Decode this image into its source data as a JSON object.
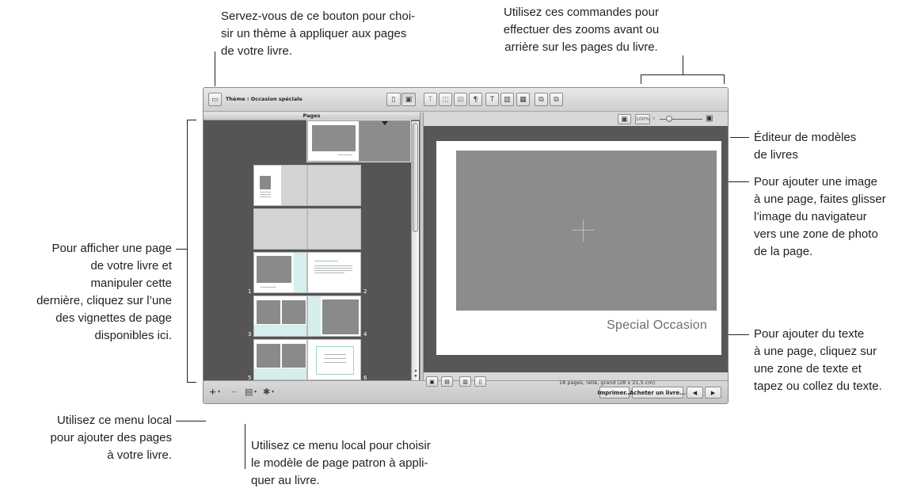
{
  "callouts": {
    "theme_button": "Servez-vous de ce bouton pour choi-\nsir un thème à appliquer aux pages\nde votre livre.",
    "zoom_controls": "Utilisez ces commandes pour\neffectuer des zooms avant ou\narrière sur les pages du livre.",
    "template_editor": "Éditeur de modèles\nde livres",
    "add_image": "Pour ajouter une image\nà une page, faites glisser\nl’image du navigateur\nvers une zone de photo\nde la page.",
    "view_page": "Pour afficher une page\nde votre livre et\nmanipuler cette\ndernière, cliquez sur l’une\ndes vignettes de page\ndisponibles ici.",
    "add_text": "Pour ajouter du texte\nà une page, cliquez sur\nune zone de texte et\ntapez ou collez du texte.",
    "add_pages_menu": "Utilisez ce menu local\npour ajouter des pages\nà votre livre.",
    "master_page_menu": "Utilisez ce menu local pour choisir\nle modèle de page patron à appli-\nquer au livre."
  },
  "toolbar": {
    "theme_label": "Thème : Occasion spéciale",
    "zoom_100_label": "100%",
    "icons": [
      "theme-icon",
      "single-page-view-icon",
      "spread-view-icon",
      "text-box-icon",
      "photo-box-icon",
      "text-style-icon",
      "stack-icon",
      "move-back-icon",
      "move-forward-icon"
    ]
  },
  "pages_panel": {
    "header": "Pages",
    "page_numbers": [
      "1",
      "2",
      "3",
      "4",
      "5",
      "6"
    ]
  },
  "editor": {
    "page_title": "Special Occasion",
    "status": "18 pages, relié, grand (28 x 21,5 cm)"
  },
  "bottom_bar": {
    "add_symbol": "+",
    "remove_symbol": "−",
    "print_label": "Imprimer...",
    "buy_label": "Acheter un livre...",
    "prev_symbol": "◀",
    "next_symbol": "▶"
  },
  "colors": {
    "panel_bg": "#555555",
    "editor_bg": "#575757",
    "photo_placeholder": "#8c8c8c",
    "page_tint": "#d6eeec"
  }
}
